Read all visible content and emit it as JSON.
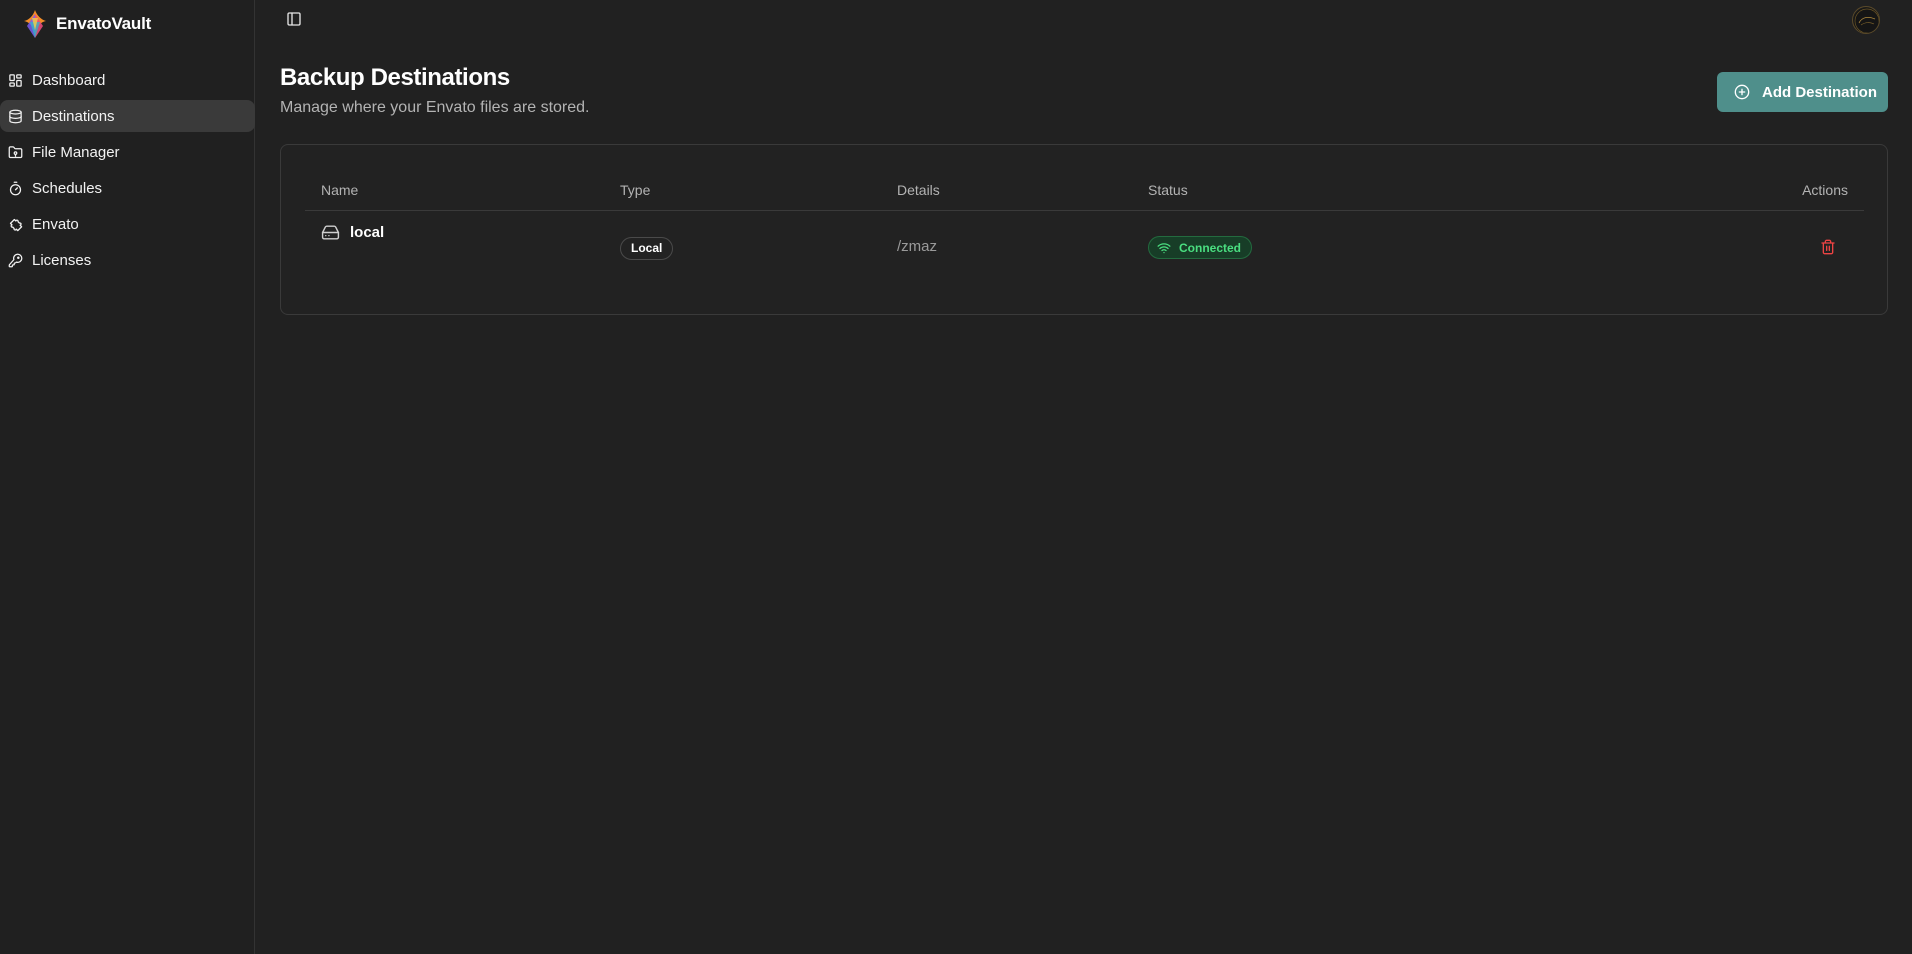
{
  "brand": {
    "name": "EnvatoVault"
  },
  "sidebar": {
    "items": [
      {
        "label": "Dashboard",
        "icon": "dashboard-icon",
        "active": false
      },
      {
        "label": "Destinations",
        "icon": "database-icon",
        "active": true
      },
      {
        "label": "File Manager",
        "icon": "folder-icon",
        "active": false
      },
      {
        "label": "Schedules",
        "icon": "timer-icon",
        "active": false
      },
      {
        "label": "Envato",
        "icon": "puzzle-icon",
        "active": false
      },
      {
        "label": "Licenses",
        "icon": "key-icon",
        "active": false
      }
    ]
  },
  "header": {
    "title": "Backup Destinations",
    "subtitle": "Manage where your Envato files are stored.",
    "add_label": "Add Destination"
  },
  "table": {
    "columns": [
      "Name",
      "Type",
      "Details",
      "Status",
      "Actions"
    ],
    "rows": [
      {
        "name": "local",
        "type": "Local",
        "details": "/zmaz",
        "status": "Connected"
      }
    ]
  },
  "colors": {
    "accent": "#4f8f8b",
    "status_connected": "#4ade80",
    "danger": "#ef4444",
    "background": "#212121"
  }
}
